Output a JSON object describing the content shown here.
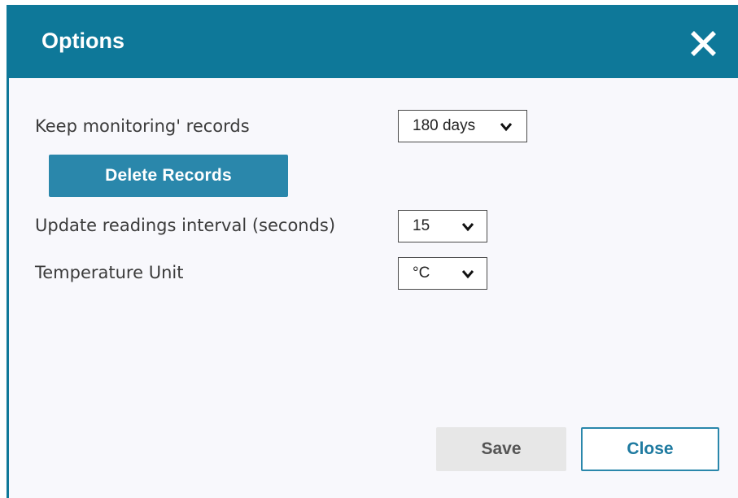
{
  "dialog": {
    "title": "Options",
    "close_icon": "close-icon",
    "header_color": "#0e7899"
  },
  "settings": {
    "keep_records": {
      "label": "Keep monitoring' records",
      "value": "180 days"
    },
    "delete_button": "Delete Records",
    "update_interval": {
      "label": "Update readings interval (seconds)",
      "value": "15"
    },
    "temperature_unit": {
      "label": "Temperature Unit",
      "value": "°C"
    }
  },
  "footer": {
    "save_label": "Save",
    "close_label": "Close"
  },
  "colors": {
    "accent": "#2a87ab",
    "save_bg": "#e7e7e7"
  }
}
